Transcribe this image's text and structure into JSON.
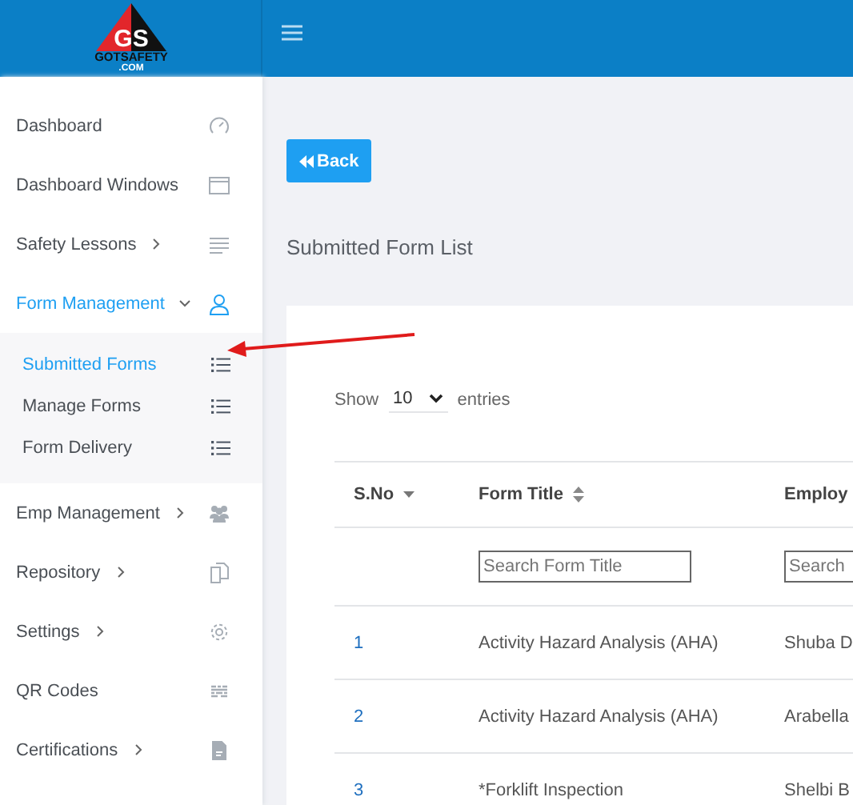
{
  "header": {
    "logo": {
      "initials": "GS",
      "name": "GOTSAFETY",
      "suffix": ".COM"
    }
  },
  "sidebar": {
    "items": [
      {
        "label": "Dashboard",
        "submenu": false,
        "selected": false
      },
      {
        "label": "Dashboard Windows",
        "submenu": false,
        "selected": false
      },
      {
        "label": "Safety Lessons",
        "submenu": true,
        "expanded": false,
        "selected": false
      },
      {
        "label": "Form Management",
        "submenu": true,
        "expanded": true,
        "selected": true,
        "children": [
          {
            "label": "Submitted Forms",
            "selected": true
          },
          {
            "label": "Manage Forms",
            "selected": false
          },
          {
            "label": "Form Delivery",
            "selected": false
          }
        ]
      },
      {
        "label": "Emp Management",
        "submenu": true,
        "expanded": false,
        "selected": false
      },
      {
        "label": "Repository",
        "submenu": true,
        "expanded": false,
        "selected": false
      },
      {
        "label": "Settings",
        "submenu": true,
        "expanded": false,
        "selected": false
      },
      {
        "label": "QR Codes",
        "submenu": false,
        "selected": false
      },
      {
        "label": "Certifications",
        "submenu": true,
        "expanded": false,
        "selected": false
      }
    ]
  },
  "back_button": "Back",
  "page_title": "Submitted Form List",
  "entries": {
    "before": "Show",
    "value": "10",
    "after": "entries"
  },
  "table": {
    "columns": [
      {
        "label": "S.No"
      },
      {
        "label": "Form Title"
      },
      {
        "label": "Employ"
      }
    ],
    "filters": [
      {
        "placeholder": "Search Form Title"
      },
      {
        "placeholder": "Search"
      }
    ],
    "rows": [
      [
        "1",
        "Activity Hazard Analysis (AHA)",
        "Shuba D"
      ],
      [
        "2",
        "Activity Hazard Analysis (AHA)",
        "Arabella"
      ],
      [
        "3",
        "*Forklift Inspection",
        "Shelbi B"
      ]
    ]
  }
}
